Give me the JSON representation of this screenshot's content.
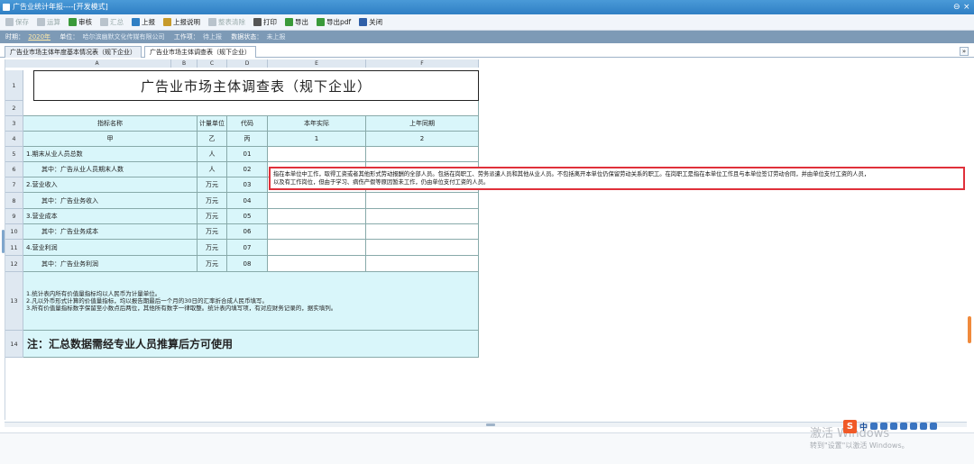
{
  "window": {
    "title": "广告业统计年报----[开发模式]",
    "controls": [
      "⊖",
      "×"
    ]
  },
  "toolbar": [
    {
      "label": "保存",
      "enabled": false,
      "icon": "save-icon",
      "color": "#b9c3cc"
    },
    {
      "label": "运算",
      "enabled": false,
      "icon": "calc-icon",
      "color": "#b9c3cc"
    },
    {
      "label": "审核",
      "enabled": true,
      "icon": "check-icon",
      "color": "#3a9a3a"
    },
    {
      "label": "汇总",
      "enabled": false,
      "icon": "sum-icon",
      "color": "#b9c3cc"
    },
    {
      "label": "上报",
      "enabled": true,
      "icon": "upload-icon",
      "color": "#2f7fc4"
    },
    {
      "label": "上报说明",
      "enabled": true,
      "icon": "note-icon",
      "color": "#c79a2a"
    },
    {
      "label": "整表清除",
      "enabled": false,
      "icon": "clear-icon",
      "color": "#b9c3cc"
    },
    {
      "label": "打印",
      "enabled": true,
      "icon": "print-icon",
      "color": "#555555"
    },
    {
      "label": "导出",
      "enabled": true,
      "icon": "export-icon",
      "color": "#3a9a3a"
    },
    {
      "label": "导出pdf",
      "enabled": true,
      "icon": "export-pdf-icon",
      "color": "#3a9a3a"
    },
    {
      "label": "关闭",
      "enabled": true,
      "icon": "close-icon",
      "color": "#2f5fa8"
    }
  ],
  "info": {
    "period_label": "时期：",
    "period_value": "2020年",
    "unit_label": "单位：",
    "unit_value": "哈尔滨幽默文化传媒有限公司",
    "task_label": "工作项：",
    "task_value": "待上报",
    "status_label": "数据状态：",
    "status_value": "未上报"
  },
  "tabs": [
    {
      "label": "广告业市场主体年度基本情况表（规下企业）",
      "active": false
    },
    {
      "label": "广告业市场主体调查表（规下企业）",
      "active": true
    }
  ],
  "tab_scroll": "»",
  "columns": [
    "A",
    "B",
    "C",
    "D",
    "E",
    "F"
  ],
  "rows": [
    "1",
    "2",
    "3",
    "4",
    "5",
    "6",
    "7",
    "8",
    "9",
    "10",
    "11",
    "12",
    "13",
    "14"
  ],
  "form": {
    "title": "广告业市场主体调查表（规下企业）",
    "headers": [
      "指标名称",
      "计量单位",
      "代码",
      "本年实际",
      "上年同期"
    ],
    "header_codes": [
      "甲",
      "乙",
      "丙",
      "1",
      "2"
    ],
    "items": [
      {
        "name": "1.期末从业人员总数",
        "unit": "人",
        "code": "01",
        "indent": false
      },
      {
        "name": "其中：广告从业人员期末人数",
        "unit": "人",
        "code": "02",
        "indent": true
      },
      {
        "name": "2.营业收入",
        "unit": "万元",
        "code": "03",
        "indent": false
      },
      {
        "name": "其中：广告业务收入",
        "unit": "万元",
        "code": "04",
        "indent": true
      },
      {
        "name": "3.营业成本",
        "unit": "万元",
        "code": "05",
        "indent": false
      },
      {
        "name": "其中：广告业务成本",
        "unit": "万元",
        "code": "06",
        "indent": true
      },
      {
        "name": "4.营业利润",
        "unit": "万元",
        "code": "07",
        "indent": false
      },
      {
        "name": "其中：广告业务利润",
        "unit": "万元",
        "code": "08",
        "indent": true
      }
    ],
    "notes": [
      "1.统计表内所有价值量指标均以人民币为计量单位。",
      "2.凡以外币形式计算的价值量指标，均以报告期最后一个月的30日的汇率折合成人民币填写。",
      "3.所有价值量指标数字保留至小数点后两位，其他所有数字一律取整。统计表内填写项，有对应财务记录的，据实填列。"
    ],
    "note14": "注：汇总数据需经专业人员推算后方可使用"
  },
  "tooltip": {
    "line1": "指在本单位中工作，取得工资或者其他形式劳动报酬的全部人员。包括在岗职工、劳务派遣人员和其他从业人员。不包括离开本单位仍保留劳动关系的职工。在岗职工是指在本单位工作且与本单位签订劳动合同，并由单位支付工资的人员，",
    "line2": "以及有工作岗位，但由于学习、病伤产假等原因暂未工作，仍由单位支付工资的人员。"
  },
  "watermark": {
    "line1": "激活 Windows",
    "line2": "转到\"设置\"以激活 Windows。"
  },
  "ime": {
    "logo": "S",
    "lang": "中"
  }
}
